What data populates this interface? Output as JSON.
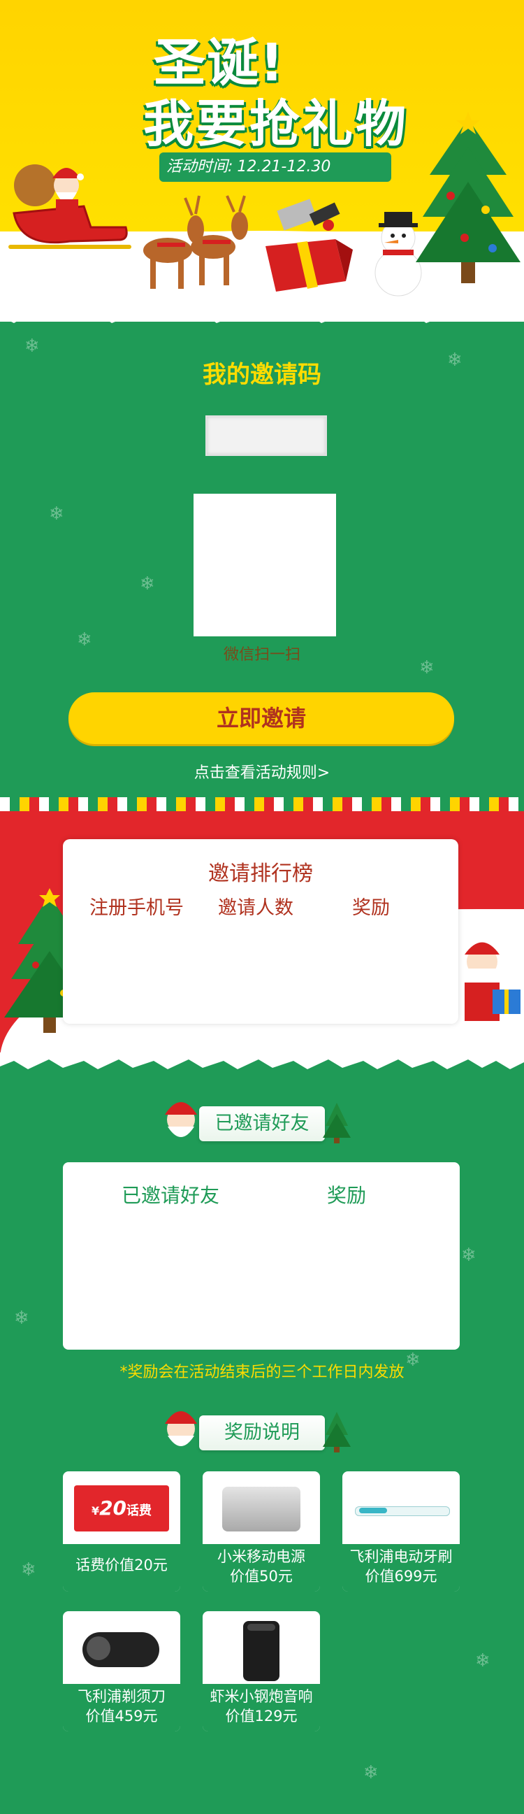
{
  "header": {
    "title_line1": "圣诞!",
    "title_line2": "我要抢礼物",
    "date_label": "活动时间:",
    "date_range": "12.21-12.30"
  },
  "invite": {
    "title": "我的邀请码",
    "qr_caption": "微信扫一扫",
    "invite_button": "立即邀请",
    "rules_link": "点击查看活动规则>"
  },
  "ranking": {
    "title": "邀请排行榜",
    "columns": [
      "注册手机号",
      "邀请人数",
      "奖励"
    ]
  },
  "friends": {
    "ribbon": "已邀请好友",
    "columns": [
      "已邀请好友",
      "奖励"
    ],
    "note": "*奖励会在活动结束后的三个工作日内发放"
  },
  "rewards": {
    "ribbon": "奖励说明",
    "items": [
      {
        "line1": "话费价值20元",
        "line2": "",
        "icon": "phone-credit-card-icon",
        "badge_symbol": "¥",
        "badge_value": "20",
        "badge_text": "话费"
      },
      {
        "line1": "小米移动电源",
        "line2": "价值50元",
        "icon": "power-bank-icon"
      },
      {
        "line1": "飞利浦电动牙刷",
        "line2": "价值699元",
        "icon": "toothbrush-icon"
      },
      {
        "line1": "飞利浦剃须刀",
        "line2": "价值459元",
        "icon": "shaver-icon"
      },
      {
        "line1": "虾米小钢炮音响",
        "line2": "价值129元",
        "icon": "speaker-icon"
      }
    ]
  },
  "colors": {
    "green": "#1f9b57",
    "yellow": "#ffd400",
    "red": "#e2262b",
    "title_brown": "#b0321f"
  }
}
